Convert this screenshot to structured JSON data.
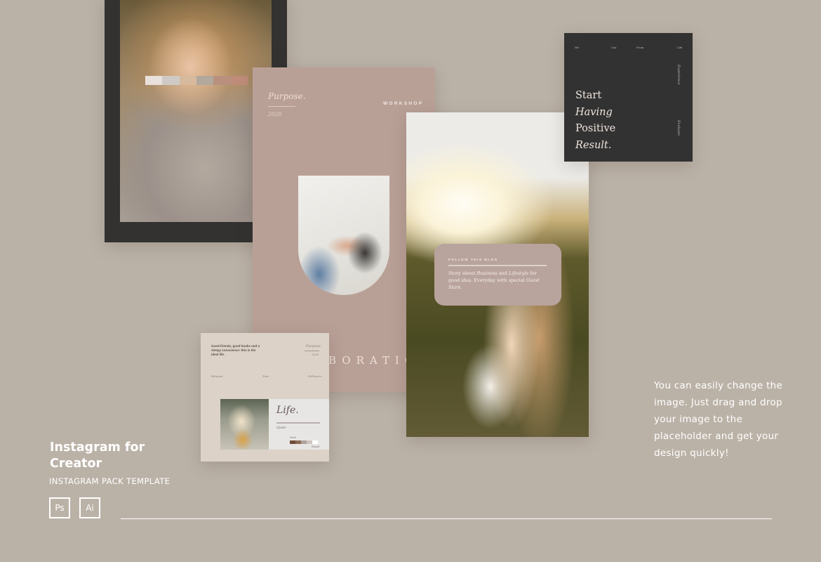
{
  "palette": {
    "background": "#bbb2a7",
    "dark_card": "#333231",
    "pink_card": "#b9a097",
    "beige_card": "#dcd2c7",
    "text_light": "#ffffff",
    "swatches": [
      "#e8e0da",
      "#cfcac6",
      "#d7b99d",
      "#b2a89c",
      "#b9907e",
      "#c08c7a"
    ],
    "gradient_bar": [
      "#6e4c3a",
      "#8a6a54",
      "#b0a39b",
      "#cfc6c0",
      "#ffffff"
    ]
  },
  "cards": {
    "purpose": {
      "title": "Purpose.",
      "year": "2020",
      "tag": "WORKSHOP",
      "collab_text": "BORATIO"
    },
    "blog": {
      "label": "FOLLOW THIS BLOG",
      "text_parts": [
        "Story about ",
        "Business",
        " and ",
        "Lifestyle",
        " for good idea. Everyday with special ",
        "Guest Stars",
        "."
      ]
    },
    "quote": {
      "nav": [
        "We",
        "Can",
        "From",
        "Life"
      ],
      "lines": [
        "Start",
        "Having",
        "Positive",
        "Result."
      ],
      "side_top": "Experience",
      "side_bottom": "Evaluate"
    },
    "beige": {
      "quote": "Good friends, good books and a sleepy conscience: this is the ideal life.",
      "purpose": "Purpose.",
      "year": "2020",
      "meta": [
        "Educate",
        "Tour",
        "Followers"
      ],
      "life_title": "Life.",
      "life_quote": "Quote",
      "dark_label": "Dark",
      "bright_label": "Bright"
    }
  },
  "branding": {
    "title_line1": "Instagram for",
    "title_line2": "Creator",
    "subtitle": "INSTAGRAM PACK TEMPLATE",
    "badges": [
      "Ps",
      "Ai"
    ]
  },
  "description": "You can easily change the image. Just drag and drop your image to the placeholder and get your design quickly!"
}
